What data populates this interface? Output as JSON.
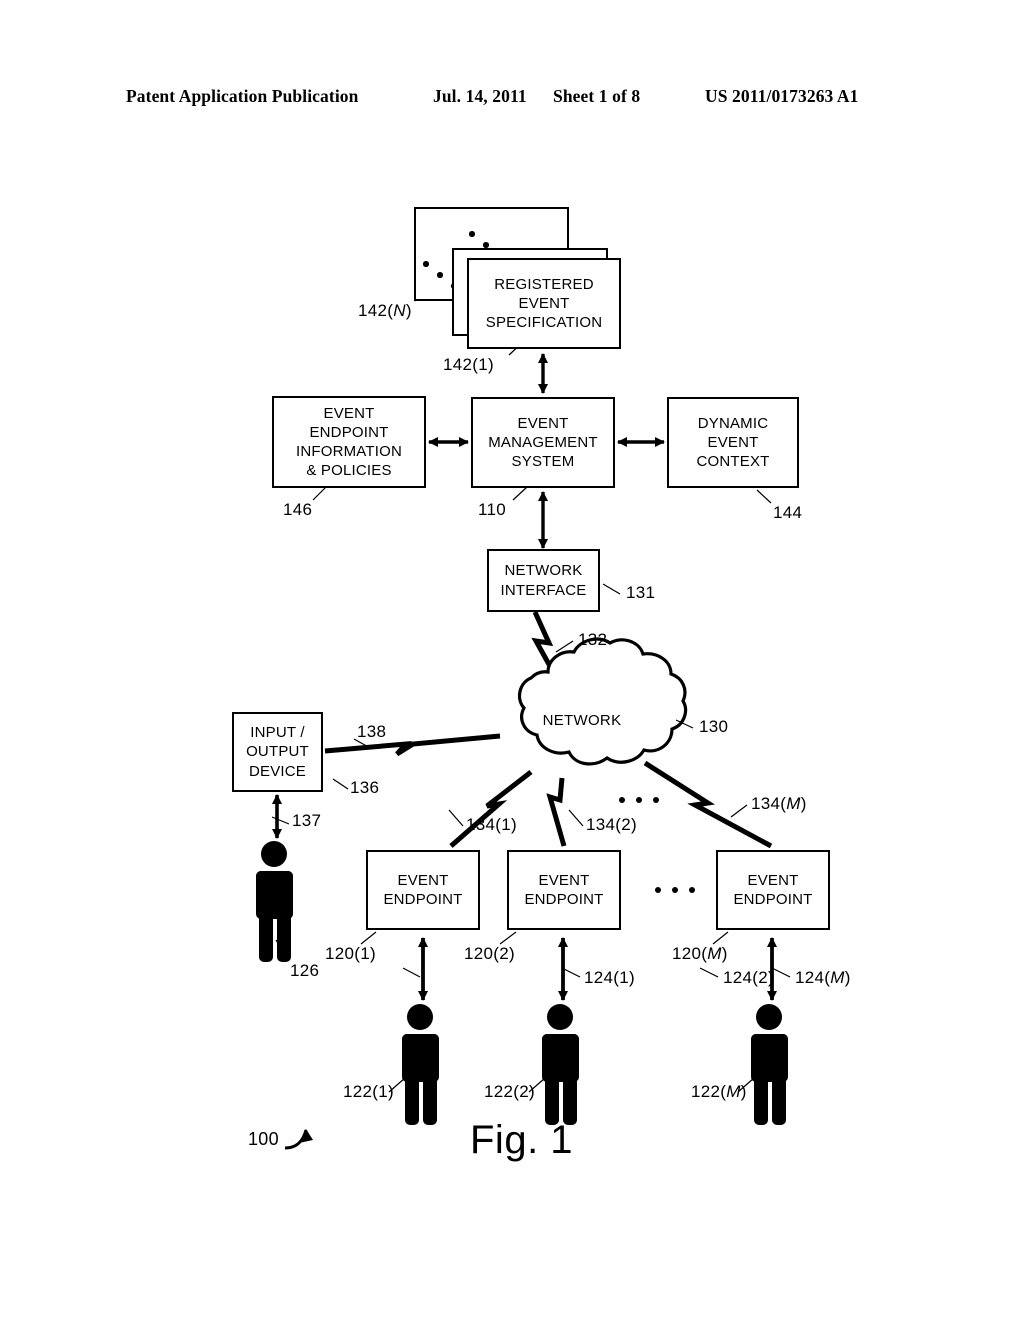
{
  "header": {
    "publication": "Patent Application Publication",
    "date": "Jul. 14, 2011",
    "sheet": "Sheet 1 of 8",
    "number": "US 2011/0173263 A1"
  },
  "figure": {
    "caption": "Fig. 1",
    "system_ref": "100"
  },
  "nodes": {
    "registered_event_spec": {
      "label": "REGISTERED\nEVENT\nSPECIFICATION",
      "line1": "REGISTERED",
      "line2": "EVENT",
      "line3": "SPECIFICATION",
      "ref_front": "142(1)",
      "ref_back": "142(N)"
    },
    "event_endpoint_info": {
      "line1": "EVENT",
      "line2": "ENDPOINT",
      "line3": "INFORMATION",
      "line4": "& POLICIES",
      "ref": "146"
    },
    "event_management_system": {
      "line1": "EVENT",
      "line2": "MANAGEMENT",
      "line3": "SYSTEM",
      "ref": "110"
    },
    "dynamic_event_context": {
      "line1": "DYNAMIC",
      "line2": "EVENT",
      "line3": "CONTEXT",
      "ref": "144"
    },
    "network_interface": {
      "line1": "NETWORK",
      "line2": "INTERFACE",
      "ref": "131"
    },
    "network_cloud": {
      "label": "NETWORK",
      "ref": "130"
    },
    "io_device": {
      "line1": "INPUT /",
      "line2": "OUTPUT",
      "line3": "DEVICE",
      "ref": "136"
    },
    "event_endpoint_1": {
      "line1": "EVENT",
      "line2": "ENDPOINT",
      "ref": "120(1)"
    },
    "event_endpoint_2": {
      "line1": "EVENT",
      "line2": "ENDPOINT",
      "ref": "120(2)"
    },
    "event_endpoint_m": {
      "line1": "EVENT",
      "line2": "ENDPOINT",
      "ref": "120(M)"
    }
  },
  "links": {
    "ni_to_network": "132",
    "io_to_network": "138",
    "io_to_user": "137",
    "network_to_ep1": "134(1)",
    "network_to_ep2": "134(2)",
    "network_to_epm": "134(M)",
    "ep1_to_user1": "124(1)",
    "ep2_to_user2": "124(2)",
    "epm_to_userm": "124(M)"
  },
  "users": {
    "admin": "126",
    "user_1": "122(1)",
    "user_2": "122(2)",
    "user_m": "122(M)"
  }
}
